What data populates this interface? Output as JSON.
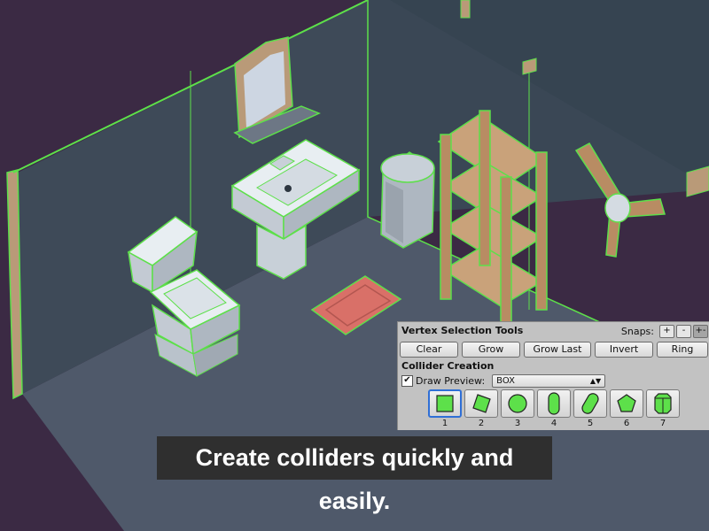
{
  "panel": {
    "title": "Vertex Selection Tools",
    "snaps_label": "Snaps:",
    "snap_buttons": [
      "+",
      "-",
      "+-"
    ],
    "buttons": [
      "Clear",
      "Grow",
      "Grow Last",
      "Invert",
      "Ring"
    ],
    "section_title": "Collider Creation",
    "draw_preview_label": "Draw Preview:",
    "draw_preview_checked": true,
    "collider_type": "BOX",
    "shapes": [
      {
        "num": "1",
        "icon": "box-icon"
      },
      {
        "num": "2",
        "icon": "rotated-box-icon"
      },
      {
        "num": "3",
        "icon": "sphere-icon"
      },
      {
        "num": "4",
        "icon": "capsule-icon"
      },
      {
        "num": "5",
        "icon": "angled-capsule-icon"
      },
      {
        "num": "6",
        "icon": "pentagon-icon"
      },
      {
        "num": "7",
        "icon": "cylinder-icon"
      }
    ],
    "selected_shape": "1"
  },
  "caption": "Create colliders quickly and easily.",
  "colors": {
    "background": "#3b2a44",
    "floor": "#4f596a",
    "wall": "#3e4a58",
    "collider_outline": "#5de04a",
    "wood": "#b88c63",
    "rug": "#d97068",
    "panel": "#c2c2c2",
    "selection": "#2f6fd6"
  }
}
